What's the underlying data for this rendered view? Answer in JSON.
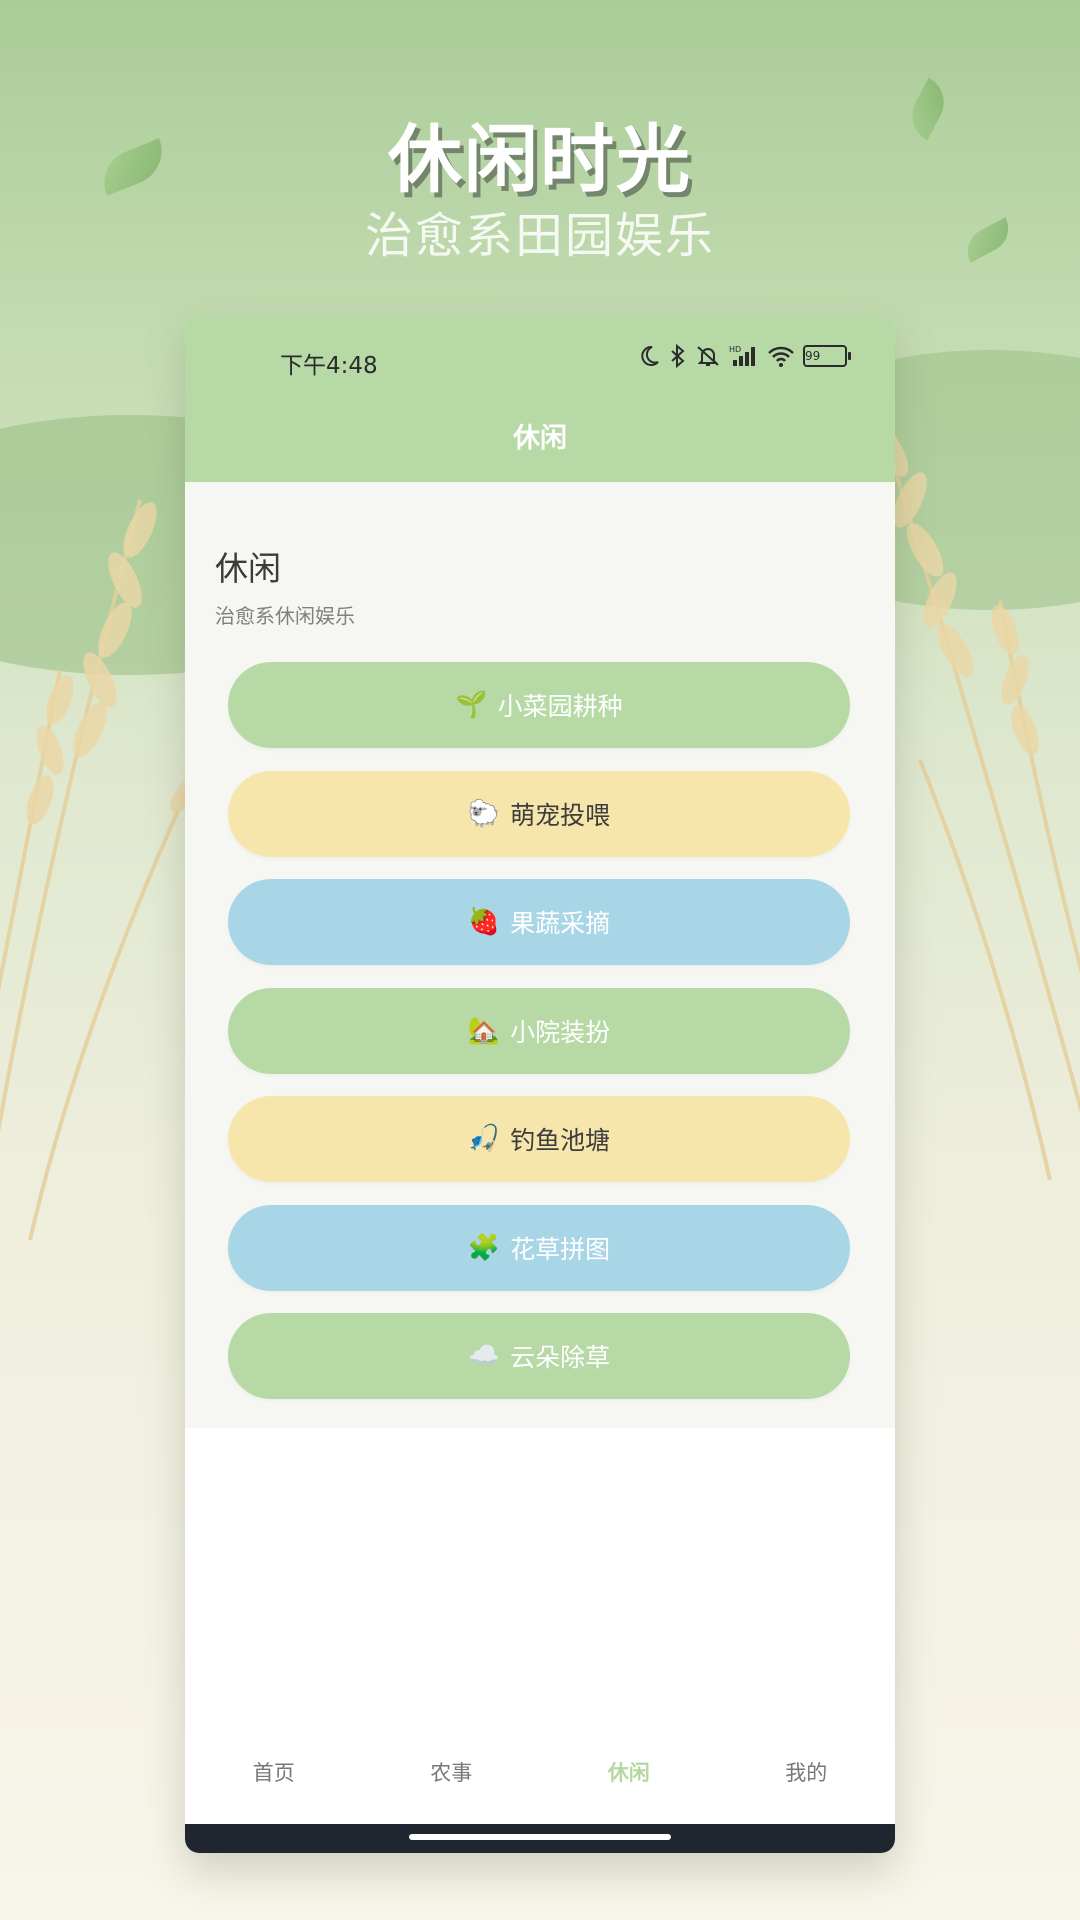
{
  "poster": {
    "headline": "休闲时光",
    "subline": "治愈系田园娱乐"
  },
  "status_bar": {
    "time": "下午4:48",
    "battery": "99",
    "icons": [
      "moon-icon",
      "bluetooth-icon",
      "silent-icon",
      "hd-signal-icon",
      "wifi-icon",
      "battery-icon"
    ]
  },
  "app_bar": {
    "title": "休闲"
  },
  "section": {
    "title": "休闲",
    "subtitle": "治愈系休闲娱乐"
  },
  "menu": [
    {
      "emoji": "🌱",
      "label": "小菜园耕种",
      "color": "#b7d9a6"
    },
    {
      "emoji": "🐑",
      "label": "萌宠投喂",
      "color": "#f6e6ab"
    },
    {
      "emoji": "🍓",
      "label": "果蔬采摘",
      "color": "#a8d6e7"
    },
    {
      "emoji": "🏡",
      "label": "小院装扮",
      "color": "#b7d9a6"
    },
    {
      "emoji": "🎣",
      "label": "钓鱼池塘",
      "color": "#f6e6ab"
    },
    {
      "emoji": "🧩",
      "label": "花草拼图",
      "color": "#a8d6e7"
    },
    {
      "emoji": "☁️",
      "label": "云朵除草",
      "color": "#b7d9a6"
    }
  ],
  "tabbar": {
    "items": [
      "首页",
      "农事",
      "休闲",
      "我的"
    ],
    "active": "休闲"
  },
  "colors": {
    "primary_green": "#b7d9a6",
    "soft_yellow": "#f6e6ab",
    "soft_blue": "#a8d6e7",
    "active_tab": "#b5d8a0"
  }
}
